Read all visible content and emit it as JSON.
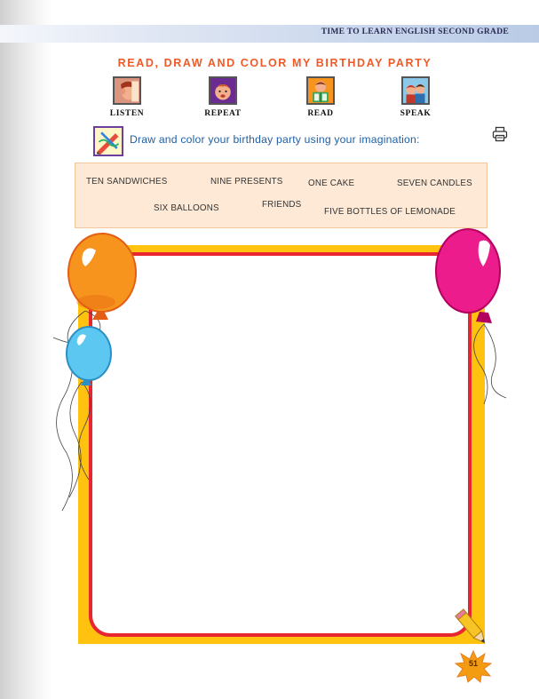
{
  "header": {
    "title": "TIME TO LEARN ENGLISH SECOND GRADE"
  },
  "page_title": "READ, DRAW AND COLOR MY BIRTHDAY PARTY",
  "skills": [
    {
      "label": "LISTEN",
      "icon": "listen-icon"
    },
    {
      "label": "REPEAT",
      "icon": "repeat-icon"
    },
    {
      "label": "READ",
      "icon": "read-icon"
    },
    {
      "label": "SPEAK",
      "icon": "speak-icon"
    }
  ],
  "instruction": {
    "icon": "pencil-drawing-icon",
    "text": "Draw and color your birthday party using your imagination:"
  },
  "print": {
    "icon": "printer-icon"
  },
  "words": [
    "TEN SANDWICHES",
    "NINE PRESENTS",
    "ONE CAKE",
    "SEVEN CANDLES",
    "SIX BALLOONS",
    "FRIENDS",
    "FIVE BOTTLES OF LEMONADE"
  ],
  "drawing_area": {
    "frame_color": "#ffc20e",
    "border_color": "#e8262f"
  },
  "balloons": [
    {
      "color": "#f7941d",
      "icon": "orange-balloon-icon"
    },
    {
      "color": "#4fc3f0",
      "icon": "blue-balloon-icon"
    },
    {
      "color": "#ec1c8c",
      "icon": "pink-balloon-icon"
    }
  ],
  "decor": {
    "icon": "pencil-icon"
  },
  "page_number": "51",
  "colors": {
    "title": "#f05a28",
    "instruction": "#1f5fa8",
    "word_box": "#fde9d5"
  }
}
